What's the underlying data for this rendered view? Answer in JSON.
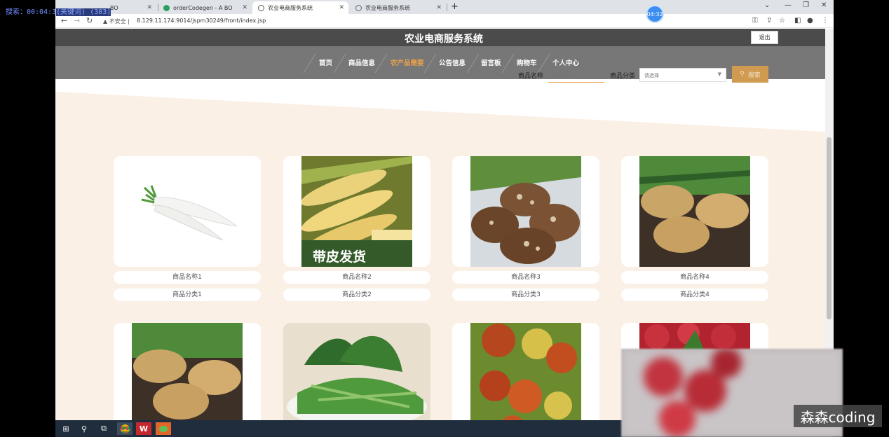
{
  "overlay": {
    "search_text": "搜索：00:04:3"
  },
  "recording_timer": "04:32",
  "browser": {
    "tabs": [
      {
        "label": "BO",
        "active": false
      },
      {
        "label": "orderCodegen - A BO",
        "active": false
      },
      {
        "label": "农业电商服务系统",
        "active": true
      },
      {
        "label": "农业电商服务系统",
        "active": false
      }
    ],
    "url_warning": "不安全",
    "url": "8.129.11.174:9014/jspm30249/front/index.jsp"
  },
  "site": {
    "title": "农业电商服务系统",
    "logout_label": "退出",
    "nav": [
      {
        "label": "首页",
        "active": false
      },
      {
        "label": "商品信息",
        "active": false
      },
      {
        "label": "农产品需要",
        "active": true
      },
      {
        "label": "公告信息",
        "active": false
      },
      {
        "label": "留言板",
        "active": false
      },
      {
        "label": "购物车",
        "active": false
      },
      {
        "label": "个人中心",
        "active": false
      }
    ],
    "search": {
      "name_label": "商品名称",
      "name_placeholder": "商品名称",
      "category_label": "商品分类",
      "category_placeholder": "请选择",
      "button_label": "搜索"
    }
  },
  "products": [
    {
      "name": "商品名称1",
      "category": "商品分类1",
      "image": "radish"
    },
    {
      "name": "商品名称2",
      "category": "商品分类2",
      "image": "corn",
      "image_text": "带皮发货"
    },
    {
      "name": "商品名称3",
      "category": "商品分类3",
      "image": "mushroom"
    },
    {
      "name": "商品名称4",
      "category": "商品分类4",
      "image": "potato"
    },
    {
      "image": "potato"
    },
    {
      "image": "greens"
    },
    {
      "image": "jujube"
    },
    {
      "image": "bayberry"
    }
  ],
  "watermark": "森森coding",
  "colors": {
    "accent": "#e8a04d",
    "header": "#4b4b4b",
    "nav": "#777777",
    "band": "#fbf0e6"
  }
}
